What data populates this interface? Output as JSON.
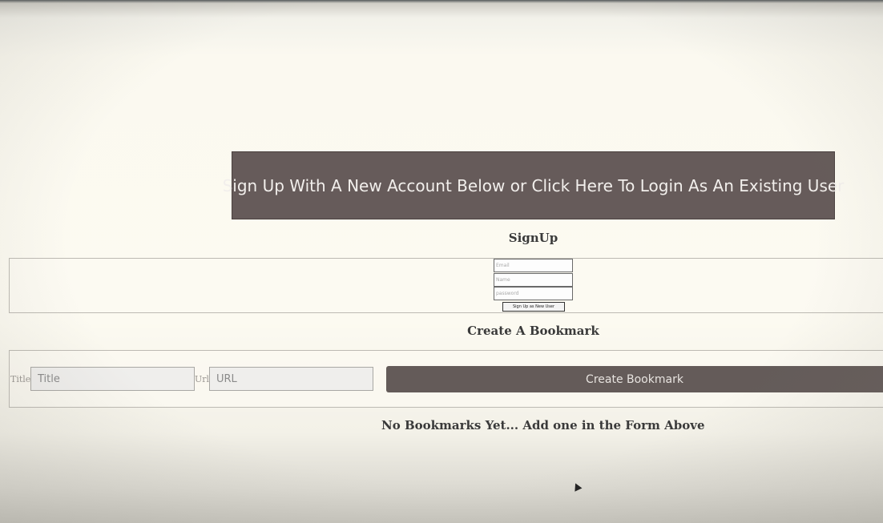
{
  "login_banner": {
    "label": "Sign Up With A New Account Below or Click Here To Login As An Existing User"
  },
  "signup": {
    "heading": "SignUp",
    "email_placeholder": "Email",
    "name_placeholder": "Name",
    "password_placeholder": "password",
    "submit_label": "Sign Up as New User"
  },
  "bookmark_form": {
    "heading": "Create A Bookmark",
    "title_label": "Title",
    "title_placeholder": "Title",
    "url_label": "Url",
    "url_placeholder": "URL",
    "submit_label": "Create Bookmark"
  },
  "bookmarks": {
    "empty_message": "No Bookmarks Yet... Add one in the Form Above"
  }
}
